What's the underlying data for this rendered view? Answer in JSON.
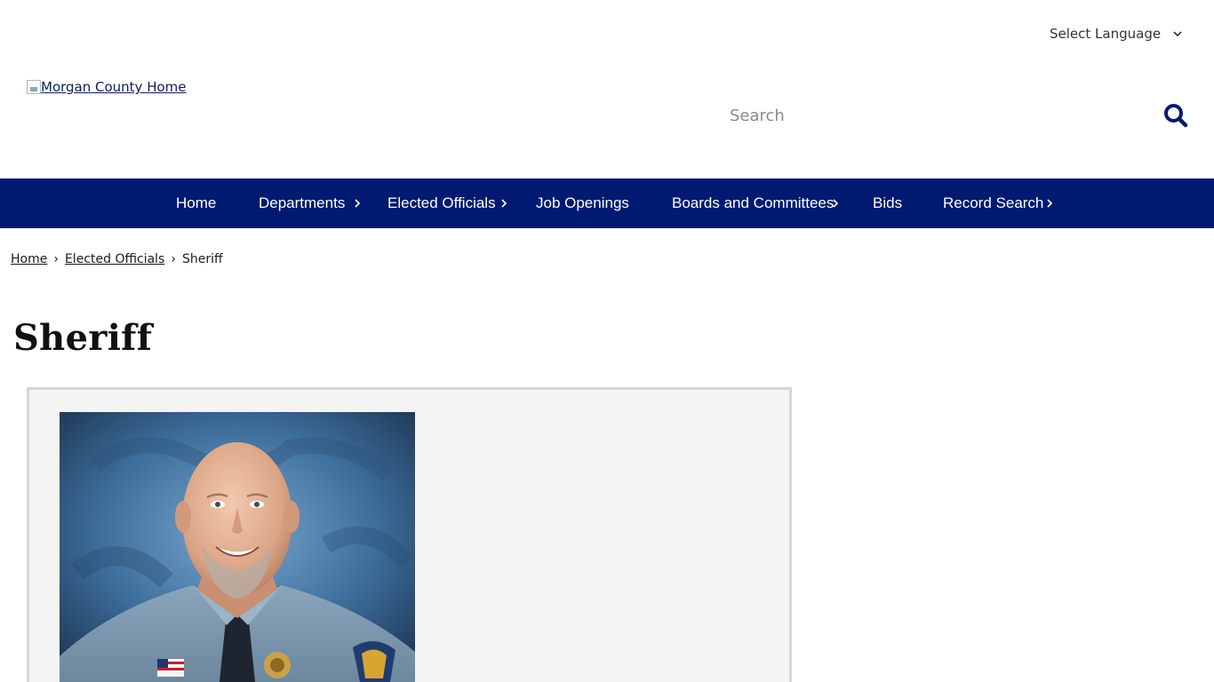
{
  "header": {
    "language_select": "Select Language",
    "logo_alt": "Morgan County Home",
    "search_placeholder": "Search"
  },
  "nav": {
    "items": [
      {
        "label": "Home",
        "has_submenu": false
      },
      {
        "label": "Departments",
        "has_submenu": true
      },
      {
        "label": "Elected Officials",
        "has_submenu": true
      },
      {
        "label": "Job Openings",
        "has_submenu": false
      },
      {
        "label": "Boards and Committees",
        "has_submenu": true
      },
      {
        "label": "Bids",
        "has_submenu": false
      },
      {
        "label": "Record Search",
        "has_submenu": true
      }
    ]
  },
  "breadcrumb": {
    "items": [
      "Home",
      "Elected Officials",
      "Sheriff"
    ],
    "separator": "›"
  },
  "page": {
    "title": "Sheriff"
  },
  "colors": {
    "nav_background": "#011a71",
    "link": "#0b1f5c",
    "content_box_background": "#f4f4f4",
    "content_box_border": "#d6d6d6",
    "uniform": "#7f9ab2"
  },
  "icons": {
    "search": "search-icon",
    "language_dropdown": "chevron-down-icon",
    "submenu": "chevron-right-icon"
  }
}
